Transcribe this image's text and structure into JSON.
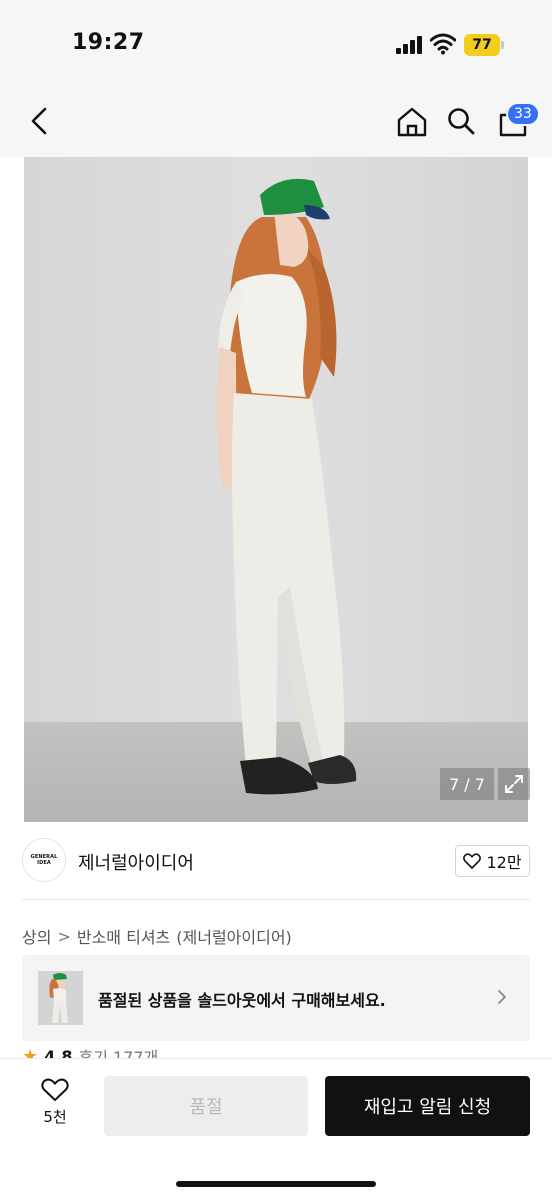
{
  "status_bar": {
    "time": "19:27",
    "battery": "77"
  },
  "nav": {
    "back_icon": "chevron-left-icon",
    "home_icon": "home-icon",
    "search_icon": "search-icon",
    "bag_icon": "shopping-bag-icon",
    "cart_count": "33",
    "badge_color": "#3571f5"
  },
  "gallery": {
    "counter": "7 / 7",
    "expand_icon": "expand-icon"
  },
  "brand": {
    "logo_text": "GENERAL IDEA",
    "name": "제너럴아이디어",
    "likes": "12만"
  },
  "breadcrumb": {
    "items": [
      "상의",
      "반소매 티셔츠",
      "(제너럴아이디어)"
    ],
    "separator": ">"
  },
  "soldout_banner": {
    "text": "품절된 상품을 솔드아웃에서 구매해보세요."
  },
  "rating": {
    "score": "4.8",
    "reviews": "후기 177개"
  },
  "bottom_bar": {
    "wish_count": "5천",
    "soldout_label": "품절",
    "restock_label": "재입고 알림 신청"
  }
}
